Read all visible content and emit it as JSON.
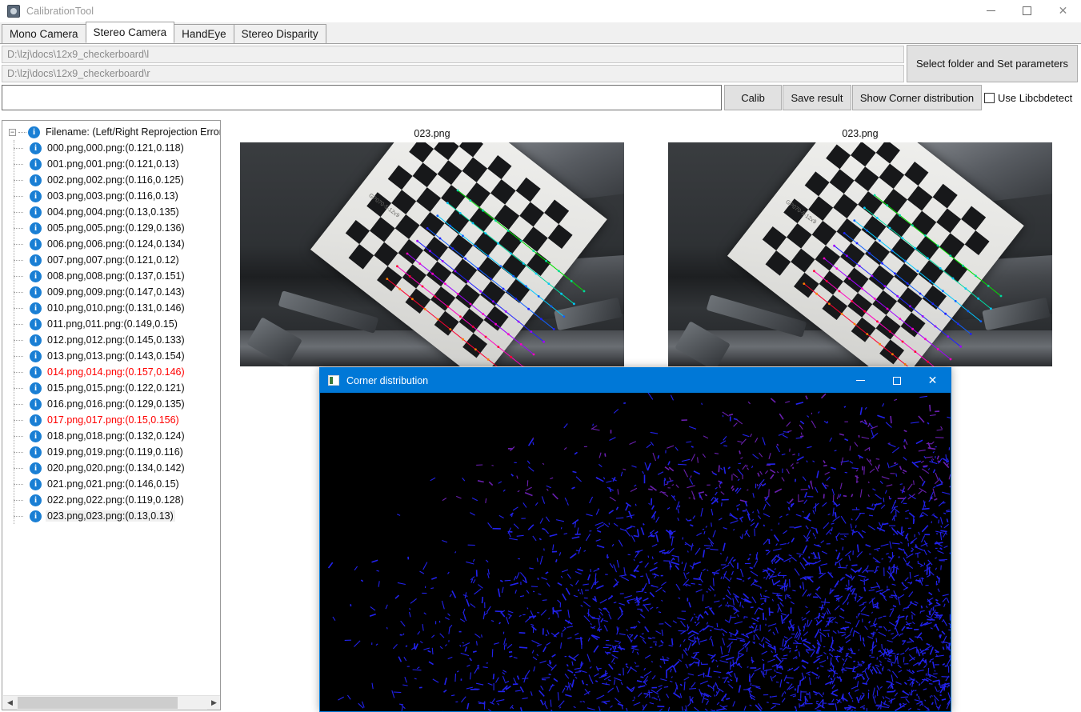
{
  "window": {
    "title": "CalibrationTool",
    "app_icon": "calibration-app-icon",
    "minimize": "—",
    "maximize": "☐",
    "close": "×"
  },
  "tabs": [
    {
      "label": "Mono Camera",
      "active": false
    },
    {
      "label": "Stereo Camera",
      "active": true
    },
    {
      "label": "HandEye",
      "active": false
    },
    {
      "label": "Stereo Disparity",
      "active": false
    }
  ],
  "paths": {
    "left_value": "D:\\lzj\\docs\\12x9_checkerboard\\l",
    "right_value": "D:\\lzj\\docs\\12x9_checkerboard\\r"
  },
  "buttons": {
    "select_folder": "Select folder and Set parameters",
    "calib": "Calib",
    "save_result": "Save result",
    "show_corner_distribution": "Show Corner distribution"
  },
  "checkbox": {
    "use_libcbdetect": "Use Libcbdetect",
    "checked": false
  },
  "log_field": {
    "value": "",
    "placeholder": ""
  },
  "tree": {
    "root_label": "Filename: (Left/Right Reprojection Error)",
    "expander": "−",
    "items": [
      {
        "label": "000.png,000.png:(0.121,0.118)",
        "error": false,
        "selected": false
      },
      {
        "label": "001.png,001.png:(0.121,0.13)",
        "error": false,
        "selected": false
      },
      {
        "label": "002.png,002.png:(0.116,0.125)",
        "error": false,
        "selected": false
      },
      {
        "label": "003.png,003.png:(0.116,0.13)",
        "error": false,
        "selected": false
      },
      {
        "label": "004.png,004.png:(0.13,0.135)",
        "error": false,
        "selected": false
      },
      {
        "label": "005.png,005.png:(0.129,0.136)",
        "error": false,
        "selected": false
      },
      {
        "label": "006.png,006.png:(0.124,0.134)",
        "error": false,
        "selected": false
      },
      {
        "label": "007.png,007.png:(0.121,0.12)",
        "error": false,
        "selected": false
      },
      {
        "label": "008.png,008.png:(0.137,0.151)",
        "error": false,
        "selected": false
      },
      {
        "label": "009.png,009.png:(0.147,0.143)",
        "error": false,
        "selected": false
      },
      {
        "label": "010.png,010.png:(0.131,0.146)",
        "error": false,
        "selected": false
      },
      {
        "label": "011.png,011.png:(0.149,0.15)",
        "error": false,
        "selected": false
      },
      {
        "label": "012.png,012.png:(0.145,0.133)",
        "error": false,
        "selected": false
      },
      {
        "label": "013.png,013.png:(0.143,0.154)",
        "error": false,
        "selected": false
      },
      {
        "label": "014.png,014.png:(0.157,0.146)",
        "error": true,
        "selected": false
      },
      {
        "label": "015.png,015.png:(0.122,0.121)",
        "error": false,
        "selected": false
      },
      {
        "label": "016.png,016.png:(0.129,0.135)",
        "error": false,
        "selected": false
      },
      {
        "label": "017.png,017.png:(0.15,0.156)",
        "error": true,
        "selected": false
      },
      {
        "label": "018.png,018.png:(0.132,0.124)",
        "error": false,
        "selected": false
      },
      {
        "label": "019.png,019.png:(0.119,0.116)",
        "error": false,
        "selected": false
      },
      {
        "label": "020.png,020.png:(0.134,0.142)",
        "error": false,
        "selected": false
      },
      {
        "label": "021.png,021.png:(0.146,0.15)",
        "error": false,
        "selected": false
      },
      {
        "label": "022.png,022.png:(0.119,0.128)",
        "error": false,
        "selected": false
      },
      {
        "label": "023.png,023.png:(0.13,0.13)",
        "error": false,
        "selected": true
      }
    ],
    "scroll_left_arrow": "◀",
    "scroll_right_arrow": "▶"
  },
  "preview": {
    "left_caption": "023.png",
    "right_caption": "023.png",
    "board_text": "GP070-5-12x9"
  },
  "dialog": {
    "title": "Corner distribution",
    "icon": "image-window-icon",
    "minimize": "—",
    "maximize": "☐",
    "close": "×"
  },
  "colors": {
    "accent": "#0078d7",
    "error_text": "#ff0000",
    "info_icon": "#1a7fd4",
    "button_face": "#e1e1e1",
    "canvas_bg": "#000000",
    "corner_primary": "#2222ee",
    "corner_secondary": "#6a1fb0"
  }
}
